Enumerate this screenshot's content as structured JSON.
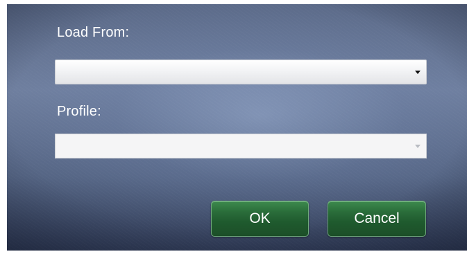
{
  "dialog": {
    "load_from": {
      "label": "Load From:",
      "selected": "",
      "icon": "chevron-down-icon"
    },
    "profile": {
      "label": "Profile:",
      "selected": "",
      "icon": "chevron-down-icon",
      "disabled": true
    },
    "buttons": {
      "ok_label": "OK",
      "cancel_label": "Cancel"
    },
    "colors": {
      "button_green": "#2a6d3a",
      "background_blue": "#5b6a88"
    }
  }
}
